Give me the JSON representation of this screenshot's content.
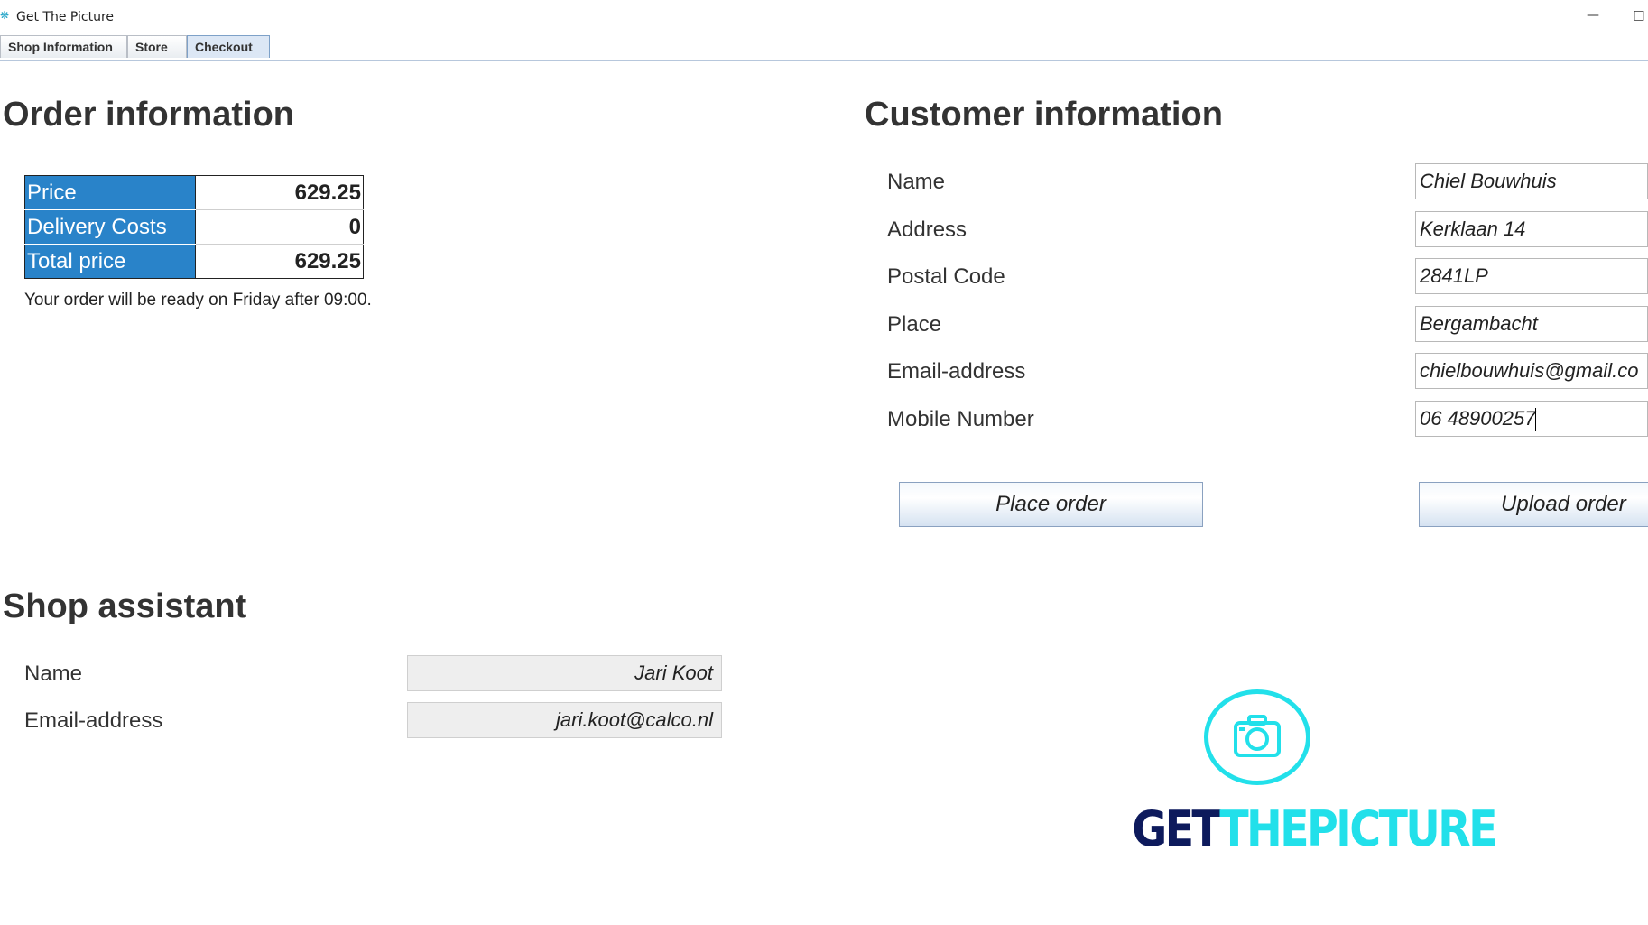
{
  "window": {
    "title": "Get The Picture",
    "minimize_glyph": "—",
    "maximize_glyph": "□"
  },
  "tabs": [
    {
      "label": "Shop Information",
      "active": false
    },
    {
      "label": "Store",
      "active": false
    },
    {
      "label": "Checkout",
      "active": true
    }
  ],
  "order": {
    "heading": "Order information",
    "rows": [
      {
        "label": "Price",
        "value": "629.25"
      },
      {
        "label": "Delivery Costs",
        "value": "0"
      },
      {
        "label": "Total price",
        "value": "629.25"
      }
    ],
    "ready_note": "Your order will be ready on Friday after 09:00."
  },
  "customer": {
    "heading": "Customer information",
    "fields": [
      {
        "label": "Name",
        "value": "Chiel Bouwhuis"
      },
      {
        "label": "Address",
        "value": "Kerklaan 14"
      },
      {
        "label": "Postal Code",
        "value": "2841LP"
      },
      {
        "label": "Place",
        "value": "Bergambacht"
      },
      {
        "label": "Email-address",
        "value": "chielbouwhuis@gmail.co"
      },
      {
        "label": "Mobile Number",
        "value": "06 48900257"
      }
    ],
    "place_order_label": "Place order",
    "upload_order_label": "Upload order"
  },
  "assistant": {
    "heading": "Shop assistant",
    "fields": [
      {
        "label": "Name",
        "value": "Jari Koot"
      },
      {
        "label": "Email-address",
        "value": "jari.koot@calco.nl"
      }
    ]
  },
  "logo": {
    "text_dark": "GET",
    "text_light": "THEPICTURE",
    "icon": "camera-icon",
    "colors": {
      "dark": "#0d1a5c",
      "light": "#22e0ea"
    }
  },
  "colors": {
    "label_blue": "#2983c9",
    "button_border": "#8aa1c0",
    "tab_active": "#dce7f5"
  }
}
